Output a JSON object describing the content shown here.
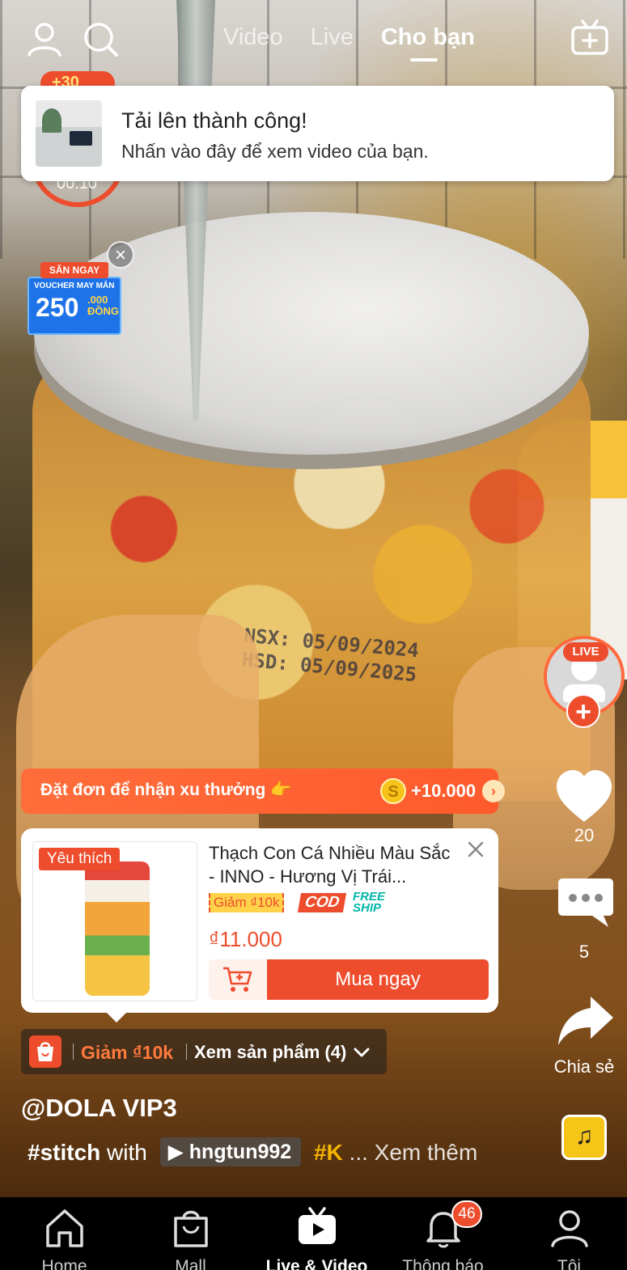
{
  "header": {
    "tabs": [
      {
        "label": "Video",
        "active": false
      },
      {
        "label": "Live",
        "active": false
      },
      {
        "label": "Cho bạn",
        "active": true
      }
    ]
  },
  "coin_badge": "+30",
  "timer": "00:10",
  "toast": {
    "title": "Tải lên thành công!",
    "subtitle": "Nhấn vào đây để xem video của bạn."
  },
  "voucher": {
    "top": "SĂN NGAY",
    "line": "VOUCHER MAY MẮN",
    "amount": "250",
    "unit_top": ".000",
    "unit_bottom": "ĐỒNG"
  },
  "video_overlay": {
    "line1": "NSX: 05/09/2024",
    "line2": "HSD: 05/09/2025"
  },
  "rail": {
    "live_label": "LIVE",
    "likes": "20",
    "comments": "5",
    "share_label": "Chia sẻ"
  },
  "reward": {
    "text": "Đặt đơn để nhận xu thưởng 👉",
    "coin_symbol": "S",
    "amount": "+10.000"
  },
  "product": {
    "tag": "Yêu thích",
    "title": "Thạch Con Cá Nhiều Màu Sắc - INNO - Hương Vị Trái...",
    "discount_badge": "Giảm ₫10k",
    "cod_badge": "COD",
    "freeship_line1": "FREE",
    "freeship_line2": "SHIP",
    "price": "₫11.000",
    "buy_label": "Mua ngay"
  },
  "shopbar": {
    "discount": "Giảm ₫10k",
    "view_products": "Xem sản phẩm (4)"
  },
  "caption": {
    "author": "@DOLA VIP3",
    "hashtag": "#stitch",
    "with": "with",
    "user": "hngtun992",
    "tag_k": "#K",
    "more": "... Xem thêm"
  },
  "bottom_nav": [
    {
      "label": "Home",
      "icon": "home-icon"
    },
    {
      "label": "Mall",
      "icon": "mall-bag-icon"
    },
    {
      "label": "Live & Video",
      "icon": "live-video-icon",
      "active": true
    },
    {
      "label": "Thông báo",
      "icon": "bell-icon",
      "badge": "46"
    },
    {
      "label": "Tôi",
      "icon": "profile-icon"
    }
  ],
  "colors": {
    "accent": "#ee4d2d",
    "gold": "#f7c31a",
    "teal": "#00b5a8"
  }
}
